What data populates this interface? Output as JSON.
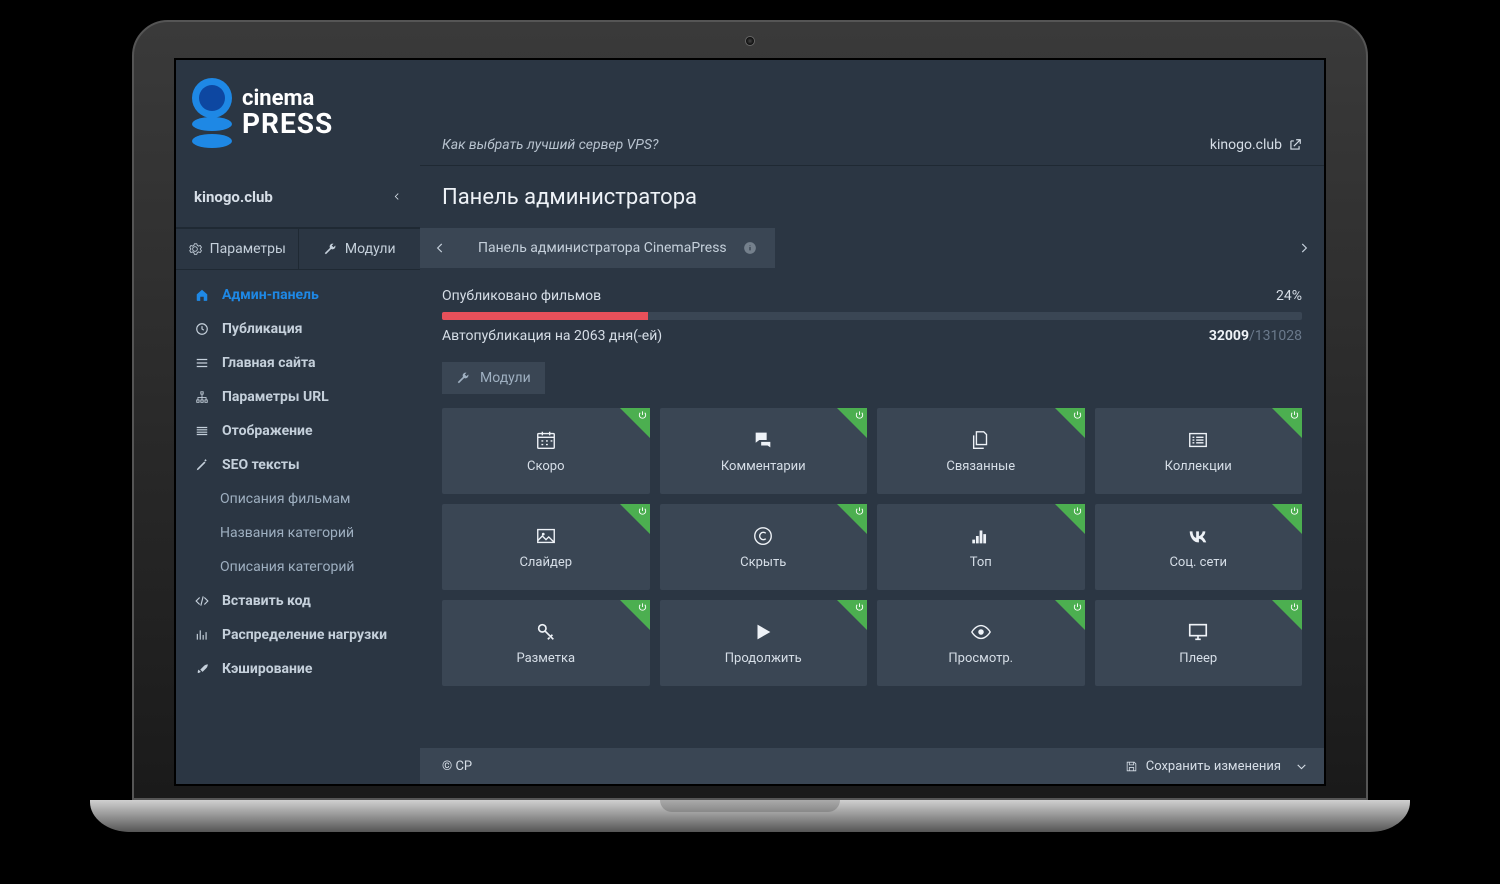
{
  "logo": {
    "line1": "cinema",
    "line2": "PRESS"
  },
  "infobar": {
    "tip": "Как выбрать лучший сервер VPS?",
    "site_link": "kinogo.club"
  },
  "site_header": "kinogo.club",
  "page_title": "Панель администратора",
  "breadcrumb": "Панель администратора CinemaPress",
  "sidebar_tabs": {
    "params": "Параметры",
    "modules": "Модули"
  },
  "nav": {
    "admin": "Админ-панель",
    "publish": "Публикация",
    "homepage": "Главная сайта",
    "url_params": "Параметры URL",
    "display": "Отображение",
    "seo": "SEO тексты",
    "seo_sub1": "Описания фильмам",
    "seo_sub2": "Названия категорий",
    "seo_sub3": "Описания категорий",
    "insert_code": "Вставить код",
    "load": "Распределение нагрузки",
    "cache": "Кэширование"
  },
  "progress": {
    "label": "Опубликовано фильмов",
    "percent_text": "24%",
    "percent_value": 24,
    "sub_left": "Автопубликация на 2063 дня(-ей)",
    "sub_right_strong": "32009",
    "sub_right_rest": "/131028"
  },
  "modules_button": "Модули",
  "tiles": [
    {
      "label": "Скоро",
      "icon": "calendar"
    },
    {
      "label": "Комментарии",
      "icon": "comments"
    },
    {
      "label": "Связанные",
      "icon": "files"
    },
    {
      "label": "Коллекции",
      "icon": "list"
    },
    {
      "label": "Слайдер",
      "icon": "image"
    },
    {
      "label": "Скрыть",
      "icon": "copyright"
    },
    {
      "label": "Топ",
      "icon": "bars"
    },
    {
      "label": "Соц. сети",
      "icon": "vk"
    },
    {
      "label": "Разметка",
      "icon": "key"
    },
    {
      "label": "Продолжить",
      "icon": "play"
    },
    {
      "label": "Просмотр.",
      "icon": "eye"
    },
    {
      "label": "Плеер",
      "icon": "monitor"
    }
  ],
  "footer": {
    "copyright": "© CP",
    "save": "Сохранить изменения"
  }
}
